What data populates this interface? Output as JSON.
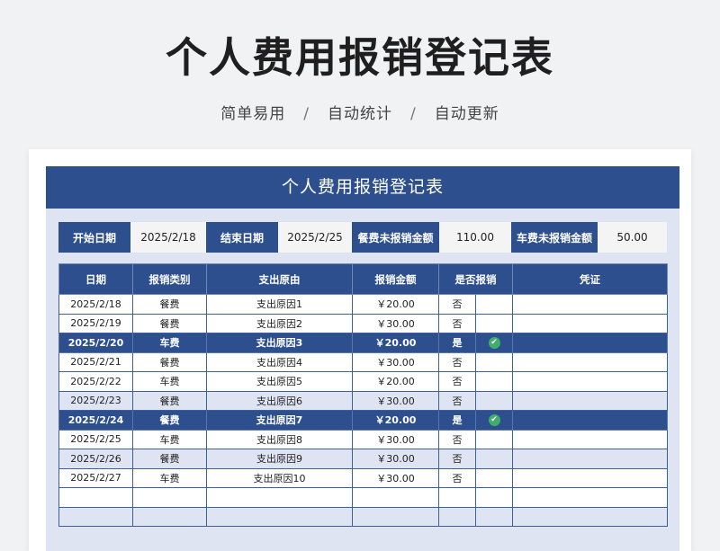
{
  "title": "个人费用报销登记表",
  "subtitle": {
    "items": [
      "简单易用",
      "自动统计",
      "自动更新"
    ],
    "separator": "/"
  },
  "sheet": {
    "header": "个人费用报销登记表",
    "summary": {
      "start_label": "开始日期",
      "start_value": "2025/2/18",
      "end_label": "结束日期",
      "end_value": "2025/2/25",
      "meal_label": "餐费未报销金额",
      "meal_value": "110.00",
      "car_label": "车费未报销金额",
      "car_value": "50.00"
    },
    "columns": [
      "日期",
      "报销类别",
      "支出原由",
      "报销金额",
      "是否报销",
      "凭证"
    ],
    "rows": [
      {
        "date": "2025/2/18",
        "category": "餐费",
        "reason": "支出原因1",
        "amount": "￥20.00",
        "reimbursed": "否",
        "checked": false
      },
      {
        "date": "2025/2/19",
        "category": "餐费",
        "reason": "支出原因2",
        "amount": "￥30.00",
        "reimbursed": "否",
        "checked": false
      },
      {
        "date": "2025/2/20",
        "category": "车费",
        "reason": "支出原因3",
        "amount": "￥20.00",
        "reimbursed": "是",
        "checked": true
      },
      {
        "date": "2025/2/21",
        "category": "餐费",
        "reason": "支出原因4",
        "amount": "￥30.00",
        "reimbursed": "否",
        "checked": false
      },
      {
        "date": "2025/2/22",
        "category": "车费",
        "reason": "支出原因5",
        "amount": "￥20.00",
        "reimbursed": "否",
        "checked": false
      },
      {
        "date": "2025/2/23",
        "category": "餐费",
        "reason": "支出原因6",
        "amount": "￥30.00",
        "reimbursed": "否",
        "checked": false
      },
      {
        "date": "2025/2/24",
        "category": "餐费",
        "reason": "支出原因7",
        "amount": "￥20.00",
        "reimbursed": "是",
        "checked": true
      },
      {
        "date": "2025/2/25",
        "category": "车费",
        "reason": "支出原因8",
        "amount": "￥30.00",
        "reimbursed": "否",
        "checked": false
      },
      {
        "date": "2025/2/26",
        "category": "餐费",
        "reason": "支出原因9",
        "amount": "￥30.00",
        "reimbursed": "否",
        "checked": false
      },
      {
        "date": "2025/2/27",
        "category": "车费",
        "reason": "支出原因10",
        "amount": "￥30.00",
        "reimbursed": "否",
        "checked": false
      },
      {
        "date": "",
        "category": "",
        "reason": "",
        "amount": "",
        "reimbursed": "",
        "checked": false
      },
      {
        "date": "",
        "category": "",
        "reason": "",
        "amount": "",
        "reimbursed": "",
        "checked": false
      }
    ],
    "check_icon": "check-circle-icon",
    "colors": {
      "header_blue": "#2d4f8e",
      "light_row": "#dfe4f3",
      "check_green": "#3fae6a"
    }
  }
}
